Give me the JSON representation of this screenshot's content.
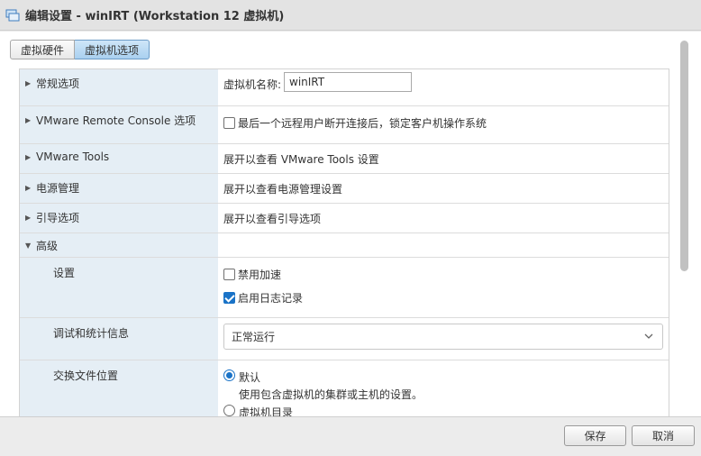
{
  "window": {
    "title": "编辑设置 - winIRT (Workstation 12 虚拟机)",
    "icon": "vm-settings-icon"
  },
  "tabs": [
    {
      "label": "虚拟硬件",
      "active": false
    },
    {
      "label": "虚拟机选项",
      "active": true
    }
  ],
  "sections": {
    "general": {
      "label": "常规选项",
      "vm_name_label": "虚拟机名称:",
      "vm_name_value": "winIRT"
    },
    "remote_console": {
      "label": "VMware Remote Console 选项",
      "lock_option": "最后一个远程用户断开连接后，锁定客户机操作系统",
      "lock_checked": false
    },
    "tools": {
      "label": "VMware Tools",
      "text": "展开以查看 VMware Tools 设置"
    },
    "power": {
      "label": "电源管理",
      "text": "展开以查看电源管理设置"
    },
    "boot": {
      "label": "引导选项",
      "text": "展开以查看引导选项"
    },
    "advanced": {
      "label": "高级",
      "settings_label": "设置",
      "disable_accel": "禁用加速",
      "disable_accel_checked": false,
      "enable_logging": "启用日志记录",
      "enable_logging_checked": true,
      "debug_label": "调试和统计信息",
      "debug_value": "正常运行",
      "swap_label": "交换文件位置",
      "swap_default": "默认",
      "swap_default_desc": "使用包含虚拟机的集群或主机的设置。",
      "swap_default_checked": true,
      "swap_vm_dir": "虚拟机目录"
    }
  },
  "footer": {
    "save": "保存",
    "cancel": "取消"
  },
  "colors": {
    "accent": "#1a73c7",
    "label_bg": "#e5eef5",
    "active_tab": "#a9d0f0"
  }
}
